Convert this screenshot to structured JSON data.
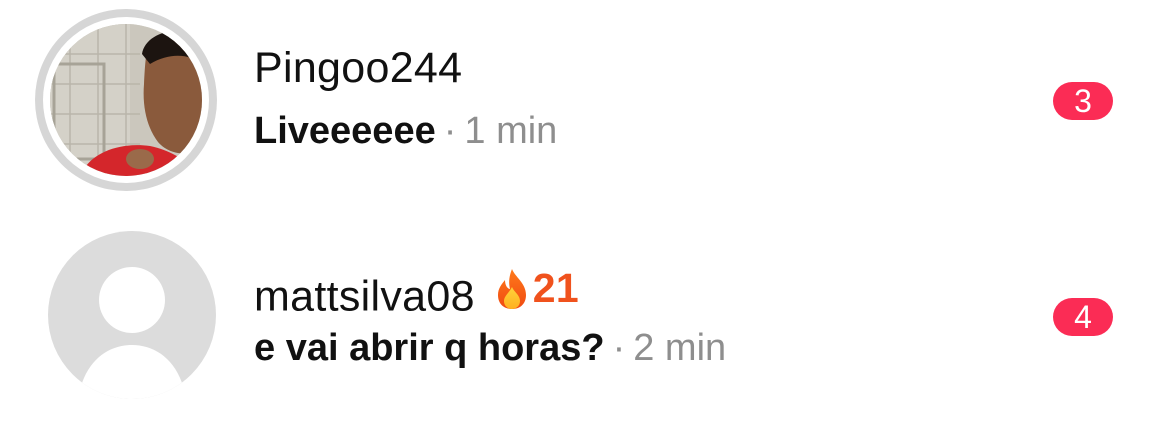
{
  "conversations": [
    {
      "username": "Pingoo244",
      "message": "Liveeeeee",
      "separator": "·",
      "time": "1 min",
      "unread_count": "3",
      "avatar": "profile-photo"
    },
    {
      "username": "mattsilva08",
      "streak_icon": "fire-icon",
      "streak_count": "21",
      "message": "e vai abrir q horas?",
      "separator": "·",
      "time": "2 min",
      "unread_count": "4",
      "avatar": "default-avatar"
    }
  ],
  "colors": {
    "badge": "#fb2c55",
    "streak": "#f0521d",
    "secondary_text": "#8e8e8e",
    "avatar_ring": "#d6d6d6",
    "placeholder_avatar": "#dcdcdc"
  }
}
